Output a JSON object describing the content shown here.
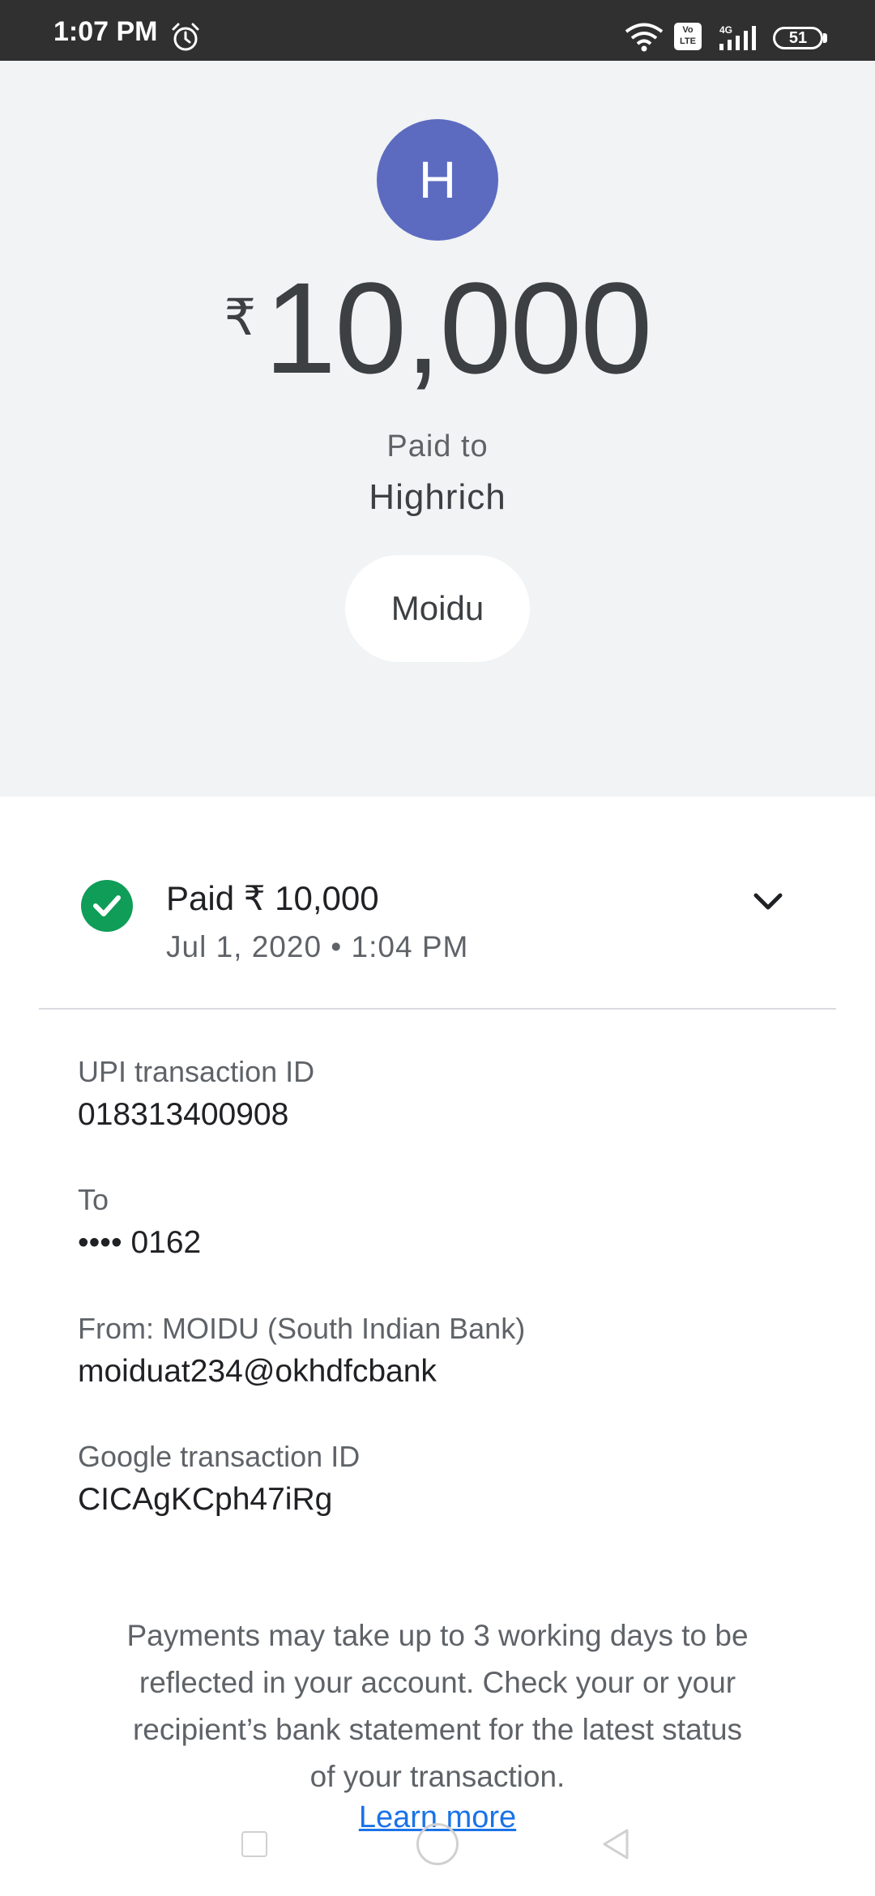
{
  "status_bar": {
    "time": "1:07 PM",
    "volte_label": "Vo\nLTE",
    "network_label": "4G",
    "battery": "51",
    "icons": [
      "alarm-icon",
      "wifi-icon",
      "volte-icon",
      "signal-icon",
      "battery-icon"
    ]
  },
  "header": {
    "avatar_letter": "H",
    "currency_symbol": "₹",
    "amount": "10,000",
    "paid_to_label": "Paid to",
    "payee_name": "Highrich",
    "chip_label": "Moidu",
    "avatar_color": "#5c6bc0"
  },
  "status": {
    "paid_text": "Paid ₹ 10,000",
    "datetime": "Jul 1, 2020 • 1:04 PM",
    "status_color": "#0f9d58"
  },
  "details": [
    {
      "label": "UPI transaction ID",
      "value": "018313400908"
    },
    {
      "label": "To",
      "value": "•••• 0162"
    },
    {
      "label": "From: MOIDU (South Indian Bank)",
      "value": "moiduat234@okhdfcbank"
    },
    {
      "label": "Google transaction ID",
      "value": "CICAgKCph47iRg"
    }
  ],
  "note": "Payments may take up to 3 working days to be reflected in your account. Check your or your recipient’s bank statement for the latest status of your transaction.",
  "learn_more": "Learn more",
  "link_color": "#1a73e8"
}
